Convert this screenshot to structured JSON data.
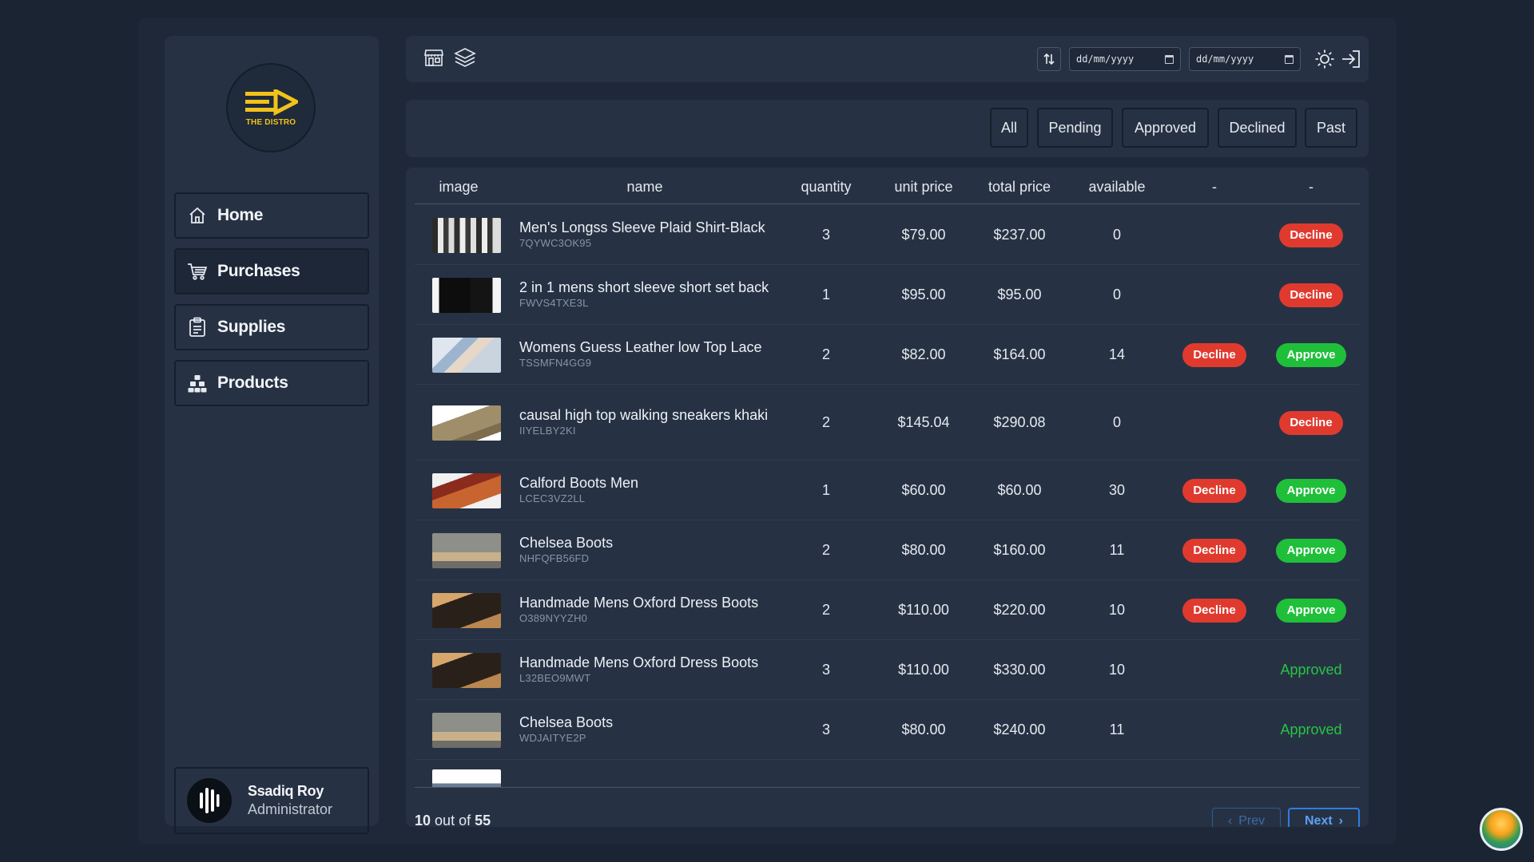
{
  "brand": {
    "name": "THE DISTRO",
    "accent": "#f2c21b"
  },
  "sidebar": {
    "items": [
      {
        "label": "Home",
        "icon": "home-icon"
      },
      {
        "label": "Purchases",
        "icon": "cart-icon"
      },
      {
        "label": "Supplies",
        "icon": "clipboard-icon"
      },
      {
        "label": "Products",
        "icon": "boxes-icon"
      }
    ],
    "active": "Purchases"
  },
  "profile": {
    "name": "Ssadiq Roy",
    "role": "Administrator"
  },
  "topbar": {
    "date_from": {
      "placeholder": "dd/mm/yyyy"
    },
    "date_to": {
      "placeholder": "dd/mm/yyyy"
    }
  },
  "filters": [
    "All",
    "Pending",
    "Approved",
    "Declined",
    "Past"
  ],
  "table": {
    "headers": {
      "image": "image",
      "name": "name",
      "quantity": "quantity",
      "unit_price": "unit price",
      "total_price": "total price",
      "available": "available",
      "action1": "-",
      "action2": "-"
    },
    "rows": [
      {
        "name": "Men's Longss Sleeve Plaid Shirt-Black",
        "code": "7QYWC3OK95",
        "quantity": "3",
        "unit_price": "$79.00",
        "total_price": "$237.00",
        "available": "0",
        "decline": "",
        "action": "Decline"
      },
      {
        "name": "2 in 1 mens short sleeve short set back",
        "code": "FWVS4TXE3L",
        "quantity": "1",
        "unit_price": "$95.00",
        "total_price": "$95.00",
        "available": "0",
        "decline": "",
        "action": "Decline"
      },
      {
        "name": "Womens Guess Leather low Top Lace",
        "code": "TSSMFN4GG9",
        "quantity": "2",
        "unit_price": "$82.00",
        "total_price": "$164.00",
        "available": "14",
        "decline": "Decline",
        "action": "Approve"
      },
      {
        "name": "causal high top walking sneakers khaki",
        "code": "IIYELBY2KI",
        "quantity": "2",
        "unit_price": "$145.04",
        "total_price": "$290.08",
        "available": "0",
        "decline": "",
        "action": "Decline"
      },
      {
        "name": "Calford Boots Men",
        "code": "LCEC3VZ2LL",
        "quantity": "1",
        "unit_price": "$60.00",
        "total_price": "$60.00",
        "available": "30",
        "decline": "Decline",
        "action": "Approve"
      },
      {
        "name": "Chelsea Boots",
        "code": "NHFQFB56FD",
        "quantity": "2",
        "unit_price": "$80.00",
        "total_price": "$160.00",
        "available": "11",
        "decline": "Decline",
        "action": "Approve"
      },
      {
        "name": "Handmade Mens Oxford Dress Boots",
        "code": "O389NYYZH0",
        "quantity": "2",
        "unit_price": "$110.00",
        "total_price": "$220.00",
        "available": "10",
        "decline": "Decline",
        "action": "Approve"
      },
      {
        "name": "Handmade Mens Oxford Dress Boots",
        "code": "L32BEO9MWT",
        "quantity": "3",
        "unit_price": "$110.00",
        "total_price": "$330.00",
        "available": "10",
        "decline": "",
        "action": "Approved"
      },
      {
        "name": "Chelsea Boots",
        "code": "WDJAITYE2P",
        "quantity": "3",
        "unit_price": "$80.00",
        "total_price": "$240.00",
        "available": "11",
        "decline": "",
        "action": "Approved"
      }
    ]
  },
  "pagination": {
    "shown": "10",
    "out_of": "out of",
    "total": "55",
    "prev": "Prev",
    "next": "Next"
  },
  "colors": {
    "decline": "#e03a2f",
    "approve": "#1fbf3a",
    "approved_text": "#27c443",
    "next_border": "#2f7de1"
  }
}
